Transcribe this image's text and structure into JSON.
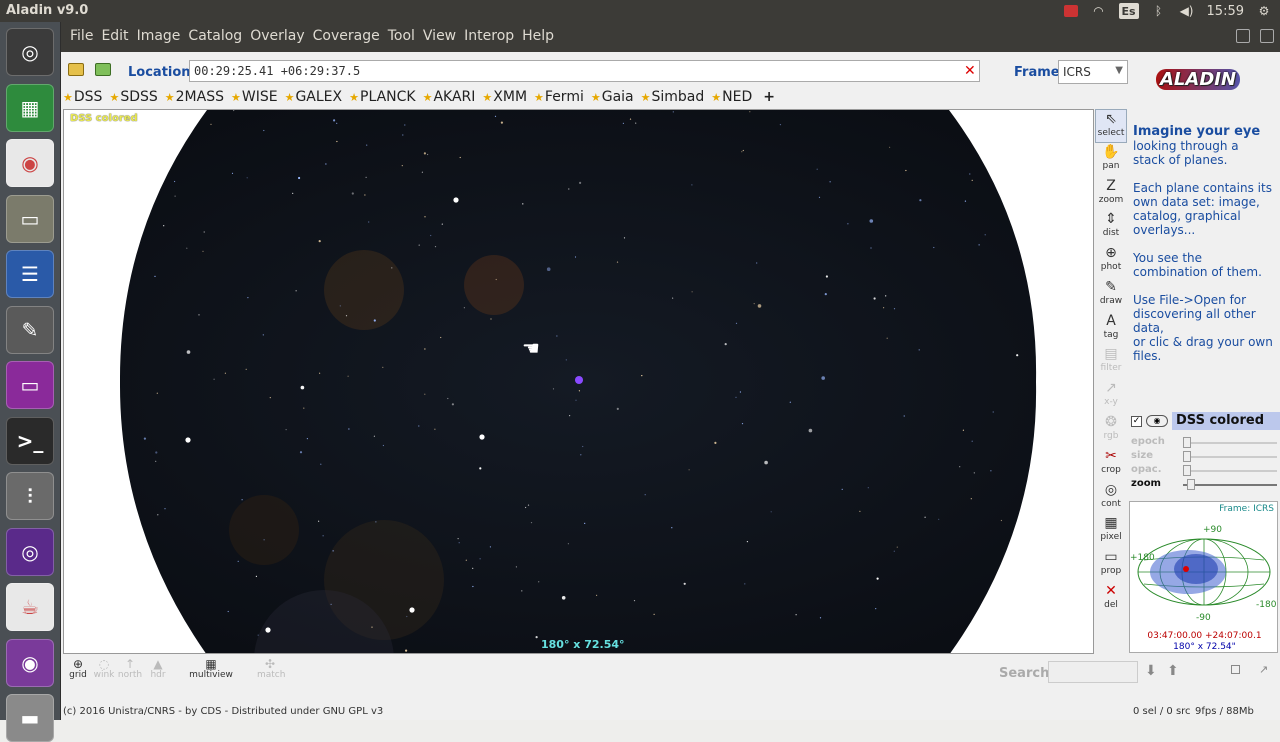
{
  "topbar": {
    "app_title": "Aladin v9.0",
    "lang": "Es",
    "clock": "15:59"
  },
  "launcher": {
    "items": [
      "ubuntu-dash-icon",
      "spreadsheet-icon",
      "chrome-icon",
      "file-manager-icon",
      "writer-icon",
      "system-settings-icon",
      "purple-app-icon",
      "terminal-icon",
      "mixer-icon",
      "aladin-icon",
      "java-icon",
      "webcam-icon",
      "drive-icon"
    ]
  },
  "menubar": {
    "items": [
      "File",
      "Edit",
      "Image",
      "Catalog",
      "Overlay",
      "Coverage",
      "Tool",
      "View",
      "Interop",
      "Help"
    ]
  },
  "toolbar": {
    "location_label": "Location",
    "location_value": "00:29:25.41 +06:29:37.5",
    "clear": "✕",
    "frame_label": "Frame",
    "frame_value": "ICRS",
    "logo": "ALADIN"
  },
  "surveys": {
    "items": [
      "DSS",
      "SDSS",
      "2MASS",
      "WISE",
      "GALEX",
      "PLANCK",
      "AKARI",
      "XMM",
      "Fermi",
      "Gaia",
      "Simbad",
      "NED"
    ],
    "add": "+"
  },
  "viewer": {
    "survey_label": "DSS colored",
    "fov_label": "180° x 72.54°"
  },
  "tools": {
    "items": [
      {
        "label": "select",
        "icon": "⇖",
        "state": "selected"
      },
      {
        "label": "pan",
        "icon": "✋",
        "state": "on"
      },
      {
        "label": "zoom",
        "icon": "Z",
        "state": "on"
      },
      {
        "label": "dist",
        "icon": "⇕",
        "state": "on"
      },
      {
        "label": "phot",
        "icon": "⊕",
        "state": "on"
      },
      {
        "label": "draw",
        "icon": "✎",
        "state": "on"
      },
      {
        "label": "tag",
        "icon": "A",
        "state": "on"
      },
      {
        "label": "filter",
        "icon": "▤",
        "state": "dim"
      },
      {
        "label": "x-y",
        "icon": "↗",
        "state": "dim"
      },
      {
        "label": "rgb",
        "icon": "❂",
        "state": "dim"
      },
      {
        "label": "crop",
        "icon": "✂",
        "state": "on"
      },
      {
        "label": "cont",
        "icon": "◎",
        "state": "on"
      },
      {
        "label": "pixel",
        "icon": "▦",
        "state": "on"
      },
      {
        "label": "prop",
        "icon": "▭",
        "state": "on"
      },
      {
        "label": "del",
        "icon": "✕",
        "state": "on"
      }
    ]
  },
  "help": {
    "heading": "Imagine your eye",
    "p1_rest": "looking through a stack of planes.",
    "p2": "Each plane contains its own data set: image, catalog, graphical overlays...",
    "p3": "You see the combination of them.",
    "p4": "Use File->Open for discovering all other data,",
    "p5": "or clic & drag your own files."
  },
  "plane": {
    "name": "DSS colored",
    "checked": "✓",
    "sliders": [
      {
        "label": "epoch",
        "enabled": false,
        "value": 0.0
      },
      {
        "label": "size",
        "enabled": false,
        "value": 0.0
      },
      {
        "label": "opac.",
        "enabled": false,
        "value": 0.0
      },
      {
        "label": "zoom",
        "enabled": true,
        "value": 0.05
      }
    ]
  },
  "map": {
    "frame": "Frame: ICRS",
    "lbl_top": "+90",
    "lbl_bottom": "-90",
    "lbl_left": "+180",
    "lbl_right": "-180",
    "coords": "03:47:00.00 +24:07:00.1",
    "fov": "180° x 72.54\""
  },
  "bottom": {
    "buttons": [
      {
        "label": "grid",
        "state": "on"
      },
      {
        "label": "wink",
        "state": "dim"
      },
      {
        "label": "north",
        "state": "dim"
      },
      {
        "label": "hdr",
        "state": "dim"
      },
      {
        "label": "multiview",
        "state": "on"
      },
      {
        "label": "match",
        "state": "dim"
      }
    ],
    "search_label": "Search"
  },
  "status": {
    "left": "(c) 2016 Unistra/CNRS - by CDS - Distributed under GNU GPL v3",
    "sel": "0 sel / 0 src",
    "fps": "9fps / 88Mb"
  },
  "colors": {
    "accent": "#1a4da0",
    "topbar": "#3c3b37",
    "sky": "#111820"
  }
}
